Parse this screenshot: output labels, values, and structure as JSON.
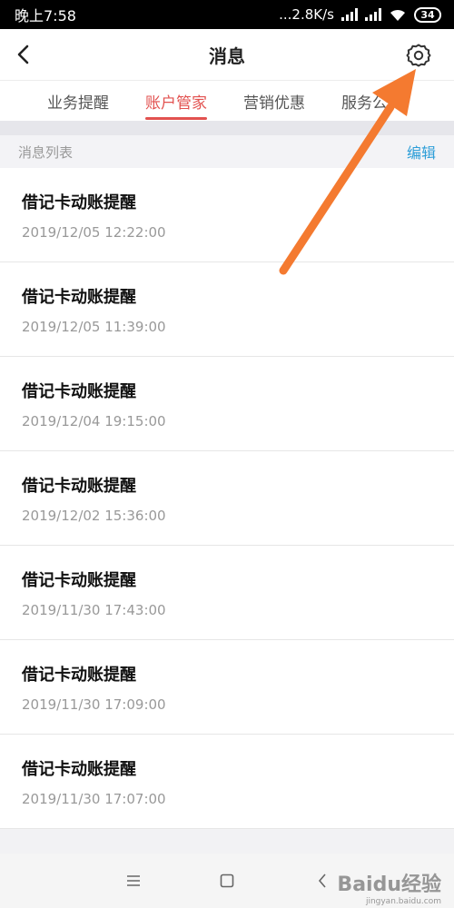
{
  "status_bar": {
    "time": "晚上7:58",
    "network_speed": "...2.8K/s",
    "battery": "34"
  },
  "navbar": {
    "title": "消息",
    "back_icon": "chevron-left-icon",
    "settings_icon": "gear-icon"
  },
  "tabs": [
    {
      "label": "业务提醒",
      "active": false
    },
    {
      "label": "账户管家",
      "active": true
    },
    {
      "label": "营销优惠",
      "active": false
    },
    {
      "label": "服务公",
      "active": false
    }
  ],
  "list_header": {
    "title": "消息列表",
    "edit_label": "编辑"
  },
  "messages": [
    {
      "title": "借记卡动账提醒",
      "time": "2019/12/05    12:22:00"
    },
    {
      "title": "借记卡动账提醒",
      "time": "2019/12/05    11:39:00"
    },
    {
      "title": "借记卡动账提醒",
      "time": "2019/12/04    19:15:00"
    },
    {
      "title": "借记卡动账提醒",
      "time": "2019/12/02    15:36:00"
    },
    {
      "title": "借记卡动账提醒",
      "time": "2019/11/30    17:43:00"
    },
    {
      "title": "借记卡动账提醒",
      "time": "2019/11/30    17:09:00"
    },
    {
      "title": "借记卡动账提醒",
      "time": "2019/11/30    17:07:00"
    }
  ],
  "bottom_nav": {
    "menu_icon": "menu-icon",
    "home_icon": "square-icon",
    "back_icon": "chevron-left-icon"
  },
  "watermark": {
    "text": "Baidu经验",
    "sub": "jingyan.baidu.com"
  },
  "colors": {
    "accent": "#e2514f",
    "link": "#2d9ed8",
    "annotation_arrow": "#f47a30"
  }
}
